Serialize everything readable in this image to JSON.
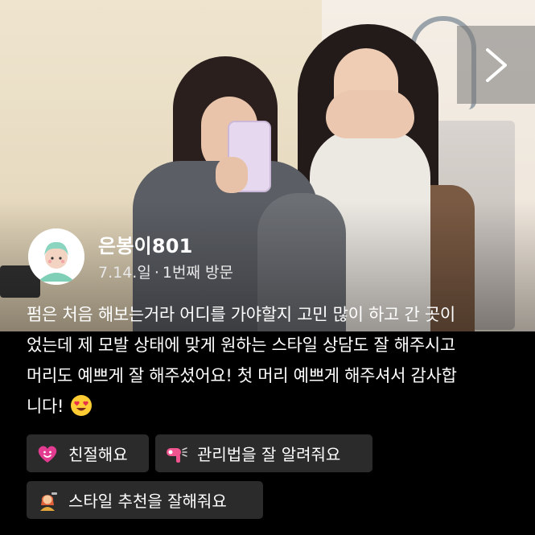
{
  "review": {
    "author": {
      "name": "은봉이801",
      "date": "7.14.일",
      "separator": "·",
      "visit": "1번째 방문"
    },
    "text_lines": [
      "펌은 처음 해보는거라 어디를 가야할지 고민 많이 하고 간 곳이",
      "었는데 제 모발 상태에 맞게 원하는 스타일 상담도 잘 해주시고",
      "머리도 예쁘게 잘 해주셨어요! 첫 머리 예쁘게 해주셔서 감사합",
      "니다!"
    ],
    "text_emoji": "heart-eyes-emoji",
    "keywords": [
      {
        "icon": "heart-face-icon",
        "label": "친절해요"
      },
      {
        "icon": "hair-dryer-icon",
        "label": "관리법을 잘 알려줘요"
      },
      {
        "icon": "stylist-icon",
        "label": "스타일 추천을 잘해줘요"
      }
    ]
  },
  "photo": {
    "next_icon": "chevron-right-icon"
  },
  "colors": {
    "background": "#000000",
    "tag_background": "#2b2b2b",
    "text": "#ffffff"
  }
}
